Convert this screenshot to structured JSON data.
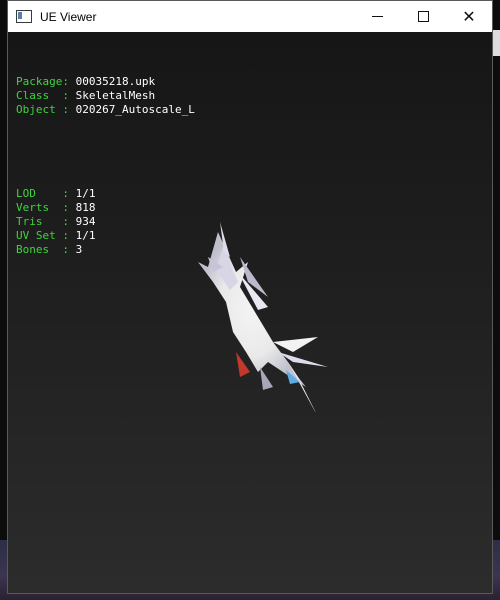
{
  "window": {
    "title": "UE Viewer",
    "minimize_label": "minimize",
    "maximize_label": "maximize",
    "close_label": "close"
  },
  "info_group1": [
    {
      "key": "Package: ",
      "value": "00035218.upk"
    },
    {
      "key": "Class  : ",
      "value": "SkeletalMesh"
    },
    {
      "key": "Object : ",
      "value": "020267_Autoscale_L"
    }
  ],
  "info_group2": [
    {
      "key": "LOD    : ",
      "value": "1/1"
    },
    {
      "key": "Verts  : ",
      "value": "818"
    },
    {
      "key": "Tris   : ",
      "value": "934"
    },
    {
      "key": "UV Set : ",
      "value": "1/1"
    },
    {
      "key": "Bones  : ",
      "value": "3"
    }
  ],
  "colors": {
    "label_green": "#3fd43f",
    "value_white": "#ffffff",
    "viewport_bg": "#1f1f1f"
  }
}
